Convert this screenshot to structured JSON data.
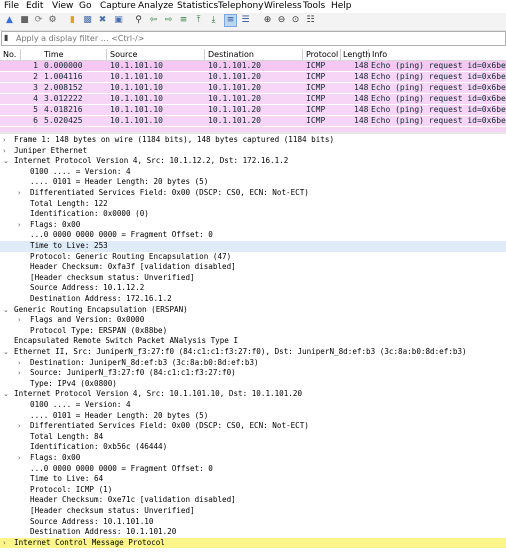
{
  "menu": [
    "File",
    "Edit",
    "View",
    "Go",
    "Capture",
    "Analyze",
    "Statistics",
    "Telephony",
    "Wireless",
    "Tools",
    "Help"
  ],
  "toolbar_icons": [
    "shark-fin-start-icon",
    "stop-icon",
    "restart-icon",
    "options-gear-icon",
    "open-file-icon",
    "file-icon",
    "close-file-icon",
    "reload-icon",
    "find-icon",
    "back-arrow-icon",
    "forward-arrow-icon",
    "goto-icon",
    "first-packet-icon",
    "last-packet-icon",
    "autoscroll-icon",
    "colorize-icon",
    "zoom-in-icon",
    "zoom-out-icon",
    "zoom-normal-icon",
    "resize-columns-icon"
  ],
  "filter": {
    "placeholder": "Apply a display filter … <Ctrl-/>"
  },
  "packet_list": {
    "columns": [
      "No.",
      "Time",
      "Source",
      "Destination",
      "Protocol",
      "Length",
      "Info"
    ],
    "rows": [
      {
        "no": "1",
        "time": "0.000000",
        "src": "10.1.101.10",
        "dst": "10.1.101.20",
        "proto": "ICMP",
        "len": "148",
        "info": "Echo (ping) request  id=0x6be"
      },
      {
        "no": "2",
        "time": "1.004116",
        "src": "10.1.101.10",
        "dst": "10.1.101.20",
        "proto": "ICMP",
        "len": "148",
        "info": "Echo (ping) request  id=0x6be"
      },
      {
        "no": "3",
        "time": "2.008152",
        "src": "10.1.101.10",
        "dst": "10.1.101.20",
        "proto": "ICMP",
        "len": "148",
        "info": "Echo (ping) request  id=0x6be"
      },
      {
        "no": "4",
        "time": "3.012222",
        "src": "10.1.101.10",
        "dst": "10.1.101.20",
        "proto": "ICMP",
        "len": "148",
        "info": "Echo (ping) request  id=0x6be"
      },
      {
        "no": "5",
        "time": "4.018216",
        "src": "10.1.101.10",
        "dst": "10.1.101.20",
        "proto": "ICMP",
        "len": "148",
        "info": "Echo (ping) request  id=0x6be"
      },
      {
        "no": "6",
        "time": "5.020425",
        "src": "10.1.101.10",
        "dst": "10.1.101.20",
        "proto": "ICMP",
        "len": "148",
        "info": "Echo (ping) request  id=0x6be"
      }
    ]
  },
  "details": [
    {
      "level": 0,
      "arrow": ">",
      "text": "Frame 1: 148 bytes on wire (1184 bits), 148 bytes captured (1184 bits)"
    },
    {
      "level": 0,
      "arrow": ">",
      "text": "Juniper Ethernet"
    },
    {
      "level": 0,
      "arrow": "v",
      "text": "Internet Protocol Version 4, Src: 10.1.12.2, Dst: 172.16.1.2"
    },
    {
      "level": 1,
      "arrow": "",
      "text": "0100 .... = Version: 4"
    },
    {
      "level": 1,
      "arrow": "",
      "text": ".... 0101 = Header Length: 20 bytes (5)"
    },
    {
      "level": 1,
      "arrow": ">",
      "text": "Differentiated Services Field: 0x00 (DSCP: CS0, ECN: Not-ECT)"
    },
    {
      "level": 1,
      "arrow": "",
      "text": "Total Length: 122"
    },
    {
      "level": 1,
      "arrow": "",
      "text": "Identification: 0x0000 (0)"
    },
    {
      "level": 1,
      "arrow": ">",
      "text": "Flags: 0x00"
    },
    {
      "level": 1,
      "arrow": "",
      "text": "...0 0000 0000 0000 = Fragment Offset: 0"
    },
    {
      "level": 1,
      "arrow": "",
      "text": "Time to Live: 253",
      "style": "highlight"
    },
    {
      "level": 1,
      "arrow": "",
      "text": "Protocol: Generic Routing Encapsulation (47)"
    },
    {
      "level": 1,
      "arrow": "",
      "text": "Header Checksum: 0xfa3f [validation disabled]"
    },
    {
      "level": 1,
      "arrow": "",
      "text": "[Header checksum status: Unverified]"
    },
    {
      "level": 1,
      "arrow": "",
      "text": "Source Address: 10.1.12.2"
    },
    {
      "level": 1,
      "arrow": "",
      "text": "Destination Address: 172.16.1.2"
    },
    {
      "level": 0,
      "arrow": "v",
      "text": "Generic Routing Encapsulation (ERSPAN)"
    },
    {
      "level": 1,
      "arrow": ">",
      "text": "Flags and Version: 0x0000"
    },
    {
      "level": 1,
      "arrow": "",
      "text": "Protocol Type: ERSPAN (0x88be)"
    },
    {
      "level": 0,
      "arrow": "",
      "text": "Encapsulated Remote Switch Packet ANalysis Type I"
    },
    {
      "level": 0,
      "arrow": "v",
      "text": "Ethernet II, Src: JuniperN_f3:27:f0 (84:c1:c1:f3:27:f0), Dst: JuniperN_8d:ef:b3 (3c:8a:b0:8d:ef:b3)"
    },
    {
      "level": 1,
      "arrow": ">",
      "text": "Destination: JuniperN_8d:ef:b3 (3c:8a:b0:8d:ef:b3)"
    },
    {
      "level": 1,
      "arrow": ">",
      "text": "Source: JuniperN_f3:27:f0 (84:c1:c1:f3:27:f0)"
    },
    {
      "level": 1,
      "arrow": "",
      "text": "Type: IPv4 (0x0800)"
    },
    {
      "level": 0,
      "arrow": "v",
      "text": "Internet Protocol Version 4, Src: 10.1.101.10, Dst: 10.1.101.20"
    },
    {
      "level": 1,
      "arrow": "",
      "text": "0100 .... = Version: 4"
    },
    {
      "level": 1,
      "arrow": "",
      "text": ".... 0101 = Header Length: 20 bytes (5)"
    },
    {
      "level": 1,
      "arrow": ">",
      "text": "Differentiated Services Field: 0x00 (DSCP: CS0, ECN: Not-ECT)"
    },
    {
      "level": 1,
      "arrow": "",
      "text": "Total Length: 84"
    },
    {
      "level": 1,
      "arrow": "",
      "text": "Identification: 0xb56c (46444)"
    },
    {
      "level": 1,
      "arrow": ">",
      "text": "Flags: 0x00"
    },
    {
      "level": 1,
      "arrow": "",
      "text": "...0 0000 0000 0000 = Fragment Offset: 0"
    },
    {
      "level": 1,
      "arrow": "",
      "text": "Time to Live: 64"
    },
    {
      "level": 1,
      "arrow": "",
      "text": "Protocol: ICMP (1)"
    },
    {
      "level": 1,
      "arrow": "",
      "text": "Header Checksum: 0xe71c [validation disabled]"
    },
    {
      "level": 1,
      "arrow": "",
      "text": "[Header checksum status: Unverified]"
    },
    {
      "level": 1,
      "arrow": "",
      "text": "Source Address: 10.1.101.10"
    },
    {
      "level": 1,
      "arrow": "",
      "text": "Destination Address: 10.1.101.20"
    },
    {
      "level": 0,
      "arrow": ">",
      "text": "Internet Control Message Protocol",
      "style": "yellow"
    }
  ]
}
